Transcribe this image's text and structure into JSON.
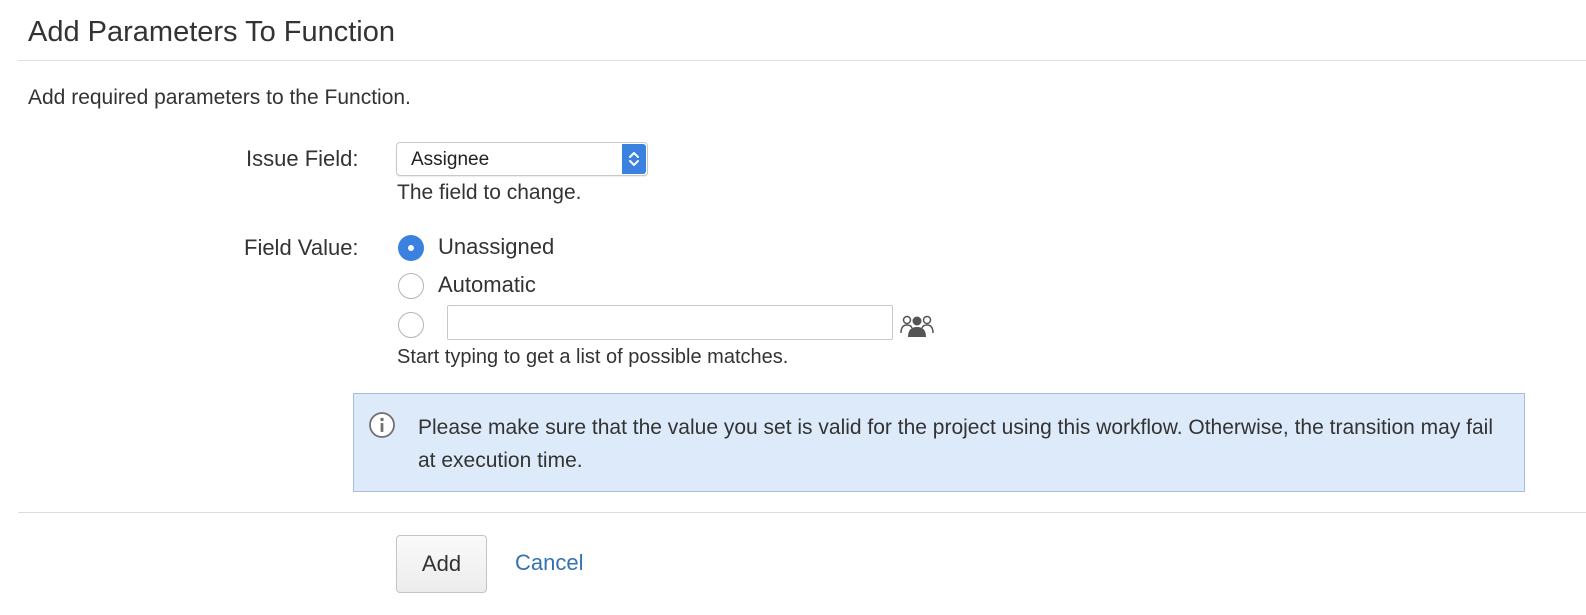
{
  "dialog": {
    "title": "Add Parameters To Function",
    "description": "Add required parameters to the Function."
  },
  "issue_field": {
    "label": "Issue Field:",
    "selected": "Assignee",
    "help": "The field to change."
  },
  "field_value": {
    "label": "Field Value:",
    "options": [
      {
        "label": "Unassigned",
        "checked": true
      },
      {
        "label": "Automatic",
        "checked": false
      },
      {
        "label": "",
        "checked": false
      }
    ],
    "user_input_value": "",
    "help": "Start typing to get a list of possible matches."
  },
  "info": {
    "message": "Please make sure that the value you set is valid for the project using this workflow. Otherwise, the transition may fail at execution time."
  },
  "actions": {
    "add_label": "Add",
    "cancel_label": "Cancel"
  },
  "colors": {
    "accent": "#3b82e0",
    "link": "#3572b0",
    "info_bg": "#ddeafa",
    "info_border": "#a6bfd8"
  },
  "icons": {
    "select": "chevron-up-down-icon",
    "user_picker": "user-group-icon",
    "info": "info-icon"
  }
}
